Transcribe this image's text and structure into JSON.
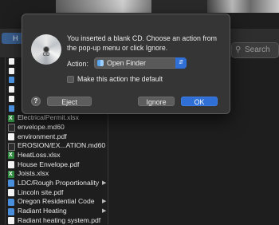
{
  "finder": {
    "path_label": "H",
    "search_placeholder": "Search",
    "files": [
      {
        "name": "",
        "icon": "blank",
        "folder": false
      },
      {
        "name": "",
        "icon": "blank",
        "folder": false
      },
      {
        "name": "",
        "icon": "blank",
        "folder": false
      },
      {
        "name": "",
        "icon": "blank",
        "folder": false
      },
      {
        "name": "",
        "icon": "blank",
        "folder": false
      },
      {
        "name": "",
        "icon": "blank",
        "folder": false
      },
      {
        "name": "ElectricalPermit.xlsx",
        "icon": "xls",
        "folder": false
      },
      {
        "name": "envelope.md60",
        "icon": "dark",
        "folder": false
      },
      {
        "name": "environment.pdf",
        "icon": "doc",
        "folder": false
      },
      {
        "name": "EROSION/EX...ATION.md60",
        "icon": "dark",
        "folder": false
      },
      {
        "name": "HeatLoss.xlsx",
        "icon": "xls",
        "folder": false
      },
      {
        "name": "House Envelope.pdf",
        "icon": "doc",
        "folder": false
      },
      {
        "name": "Joists.xlsx",
        "icon": "xls",
        "folder": false
      },
      {
        "name": "LDC/Rough Proportionality",
        "icon": "folder",
        "folder": true
      },
      {
        "name": "Lincoln site.pdf",
        "icon": "doc",
        "folder": false
      },
      {
        "name": "Oregon Residential Code",
        "icon": "folder",
        "folder": true
      },
      {
        "name": "Radiant Heating",
        "icon": "folder",
        "folder": true
      },
      {
        "name": "Radiant heating system.pdf",
        "icon": "doc",
        "folder": false
      }
    ]
  },
  "dialog": {
    "icon": "blank-cd-icon",
    "cd_label": "CD",
    "message": "You inserted a blank CD. Choose an action from the pop-up menu or click Ignore.",
    "action_label": "Action:",
    "action_value": "Open Finder",
    "default_checkbox_label": "Make this action the default",
    "default_checked": false,
    "help_label": "?",
    "eject_label": "Eject",
    "ignore_label": "Ignore",
    "ok_label": "OK"
  },
  "colors": {
    "accent": "#2f6fd6",
    "dialog_bg": "#353535",
    "window_bg": "#1e1e1e"
  }
}
